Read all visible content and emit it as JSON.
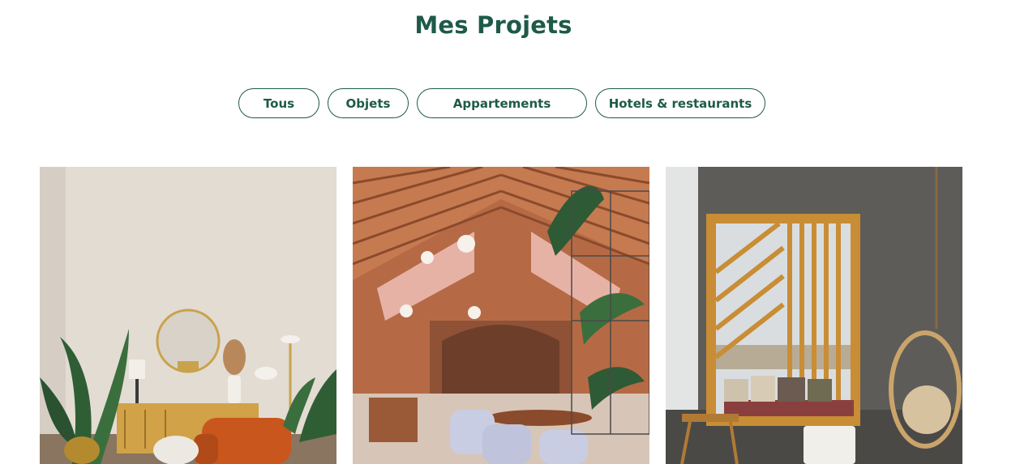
{
  "page": {
    "title": "Mes Projets"
  },
  "filters": [
    {
      "label": "Tous"
    },
    {
      "label": "Objets"
    },
    {
      "label": "Appartements"
    },
    {
      "label": "Hotels & restaurants"
    }
  ],
  "colors": {
    "brand": "#1e5a48",
    "background": "#ffffff"
  },
  "projects": [
    {
      "image": "living-room-photo"
    },
    {
      "image": "restaurant-interior-photo"
    },
    {
      "image": "hotel-lounge-photo"
    }
  ]
}
